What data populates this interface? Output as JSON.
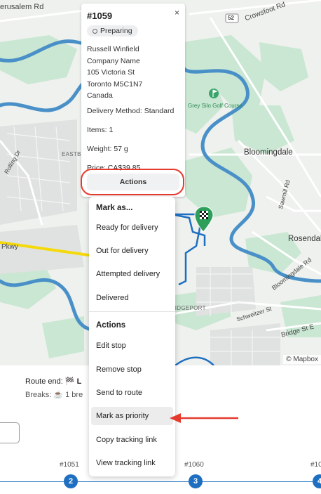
{
  "map": {
    "labels": {
      "jerusalem": "erusalem Rd",
      "crowsfoot": "Crowsfoot Rd",
      "hwy": "52",
      "grey_silo": "Grey Silo Golf Course",
      "eastbridge": "EASTBRIDGE",
      "bloomingdale": "Bloomingdale",
      "sawmill": "Sawmill Rd",
      "rosendale": "Rosendale",
      "bloomingdale_rd": "Bloomingdale Rd",
      "bridgeport": "BRIDGEPORT",
      "schweitzer": "Schweitzer St",
      "bridge_st": "Bridge St E",
      "pkwy": "Pkwy",
      "rolling_dr": "Rolling Dr"
    },
    "attribution": "© Mapbox"
  },
  "popup": {
    "order_id": "#1059",
    "status": "Preparing",
    "address": [
      "Russell Winfield",
      "Company Name",
      "105 Victoria St",
      "Toronto M5C1N7",
      "Canada"
    ],
    "delivery_method": "Delivery Method: Standard",
    "items": "Items: 1",
    "weight": "Weight: 57 g",
    "price": "Price: CA$39.85",
    "actions_label": "Actions",
    "close_glyph": "×"
  },
  "menu": {
    "mark_as_heading": "Mark as...",
    "mark_as_items": [
      "Ready for delivery",
      "Out for delivery",
      "Attempted delivery",
      "Delivered"
    ],
    "actions_heading": "Actions",
    "action_items": [
      "Edit stop",
      "Remove stop",
      "Send to route",
      "Mark as priority",
      "Copy tracking link",
      "View tracking link"
    ],
    "hovered_item": "Mark as priority"
  },
  "route_panel": {
    "route_end_label": "Route end:",
    "route_end_icon": "🏁",
    "route_end_value": "L",
    "breaks_label": "Breaks:",
    "breaks_icon": "☕",
    "breaks_value": "1 bre"
  },
  "timeline": {
    "stops": [
      {
        "label": "#1051",
        "number": "2"
      },
      {
        "label": "#1060",
        "number": "3"
      },
      {
        "label": "#10",
        "number": "4"
      }
    ]
  },
  "colors": {
    "highlight_red": "#e53b2f",
    "route_blue": "#1f6fc1",
    "river_blue": "#4a90c8",
    "park_green": "#b9e0c8"
  }
}
